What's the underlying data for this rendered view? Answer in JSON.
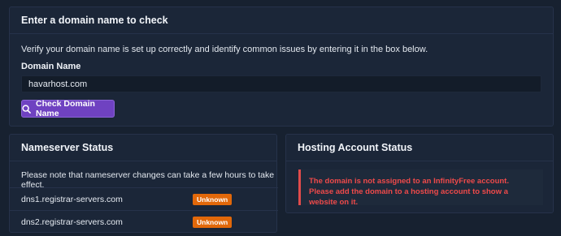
{
  "check_card": {
    "title": "Enter a domain name to check",
    "description": "Verify your domain name is set up correctly and identify common issues by entering it in the box below.",
    "field_label": "Domain Name",
    "domain_value": "havarhost.com",
    "button_label": "Check Domain Name",
    "button_icon": "search-icon",
    "accent_color": "#6f42c1"
  },
  "nameserver_card": {
    "title": "Nameserver Status",
    "note": "Please note that nameserver changes can take a few hours to take effect.",
    "rows": [
      {
        "host": "dns1.registrar-servers.com",
        "status": "Unknown"
      },
      {
        "host": "dns2.registrar-servers.com",
        "status": "Unknown"
      }
    ],
    "badge_color": "#e2680a"
  },
  "hosting_card": {
    "title": "Hosting Account Status",
    "alert": "The domain is not assigned to an InfinityFree account. Please add the domain to a hosting account to show a website on it.",
    "alert_color": "#ef4a4a"
  }
}
